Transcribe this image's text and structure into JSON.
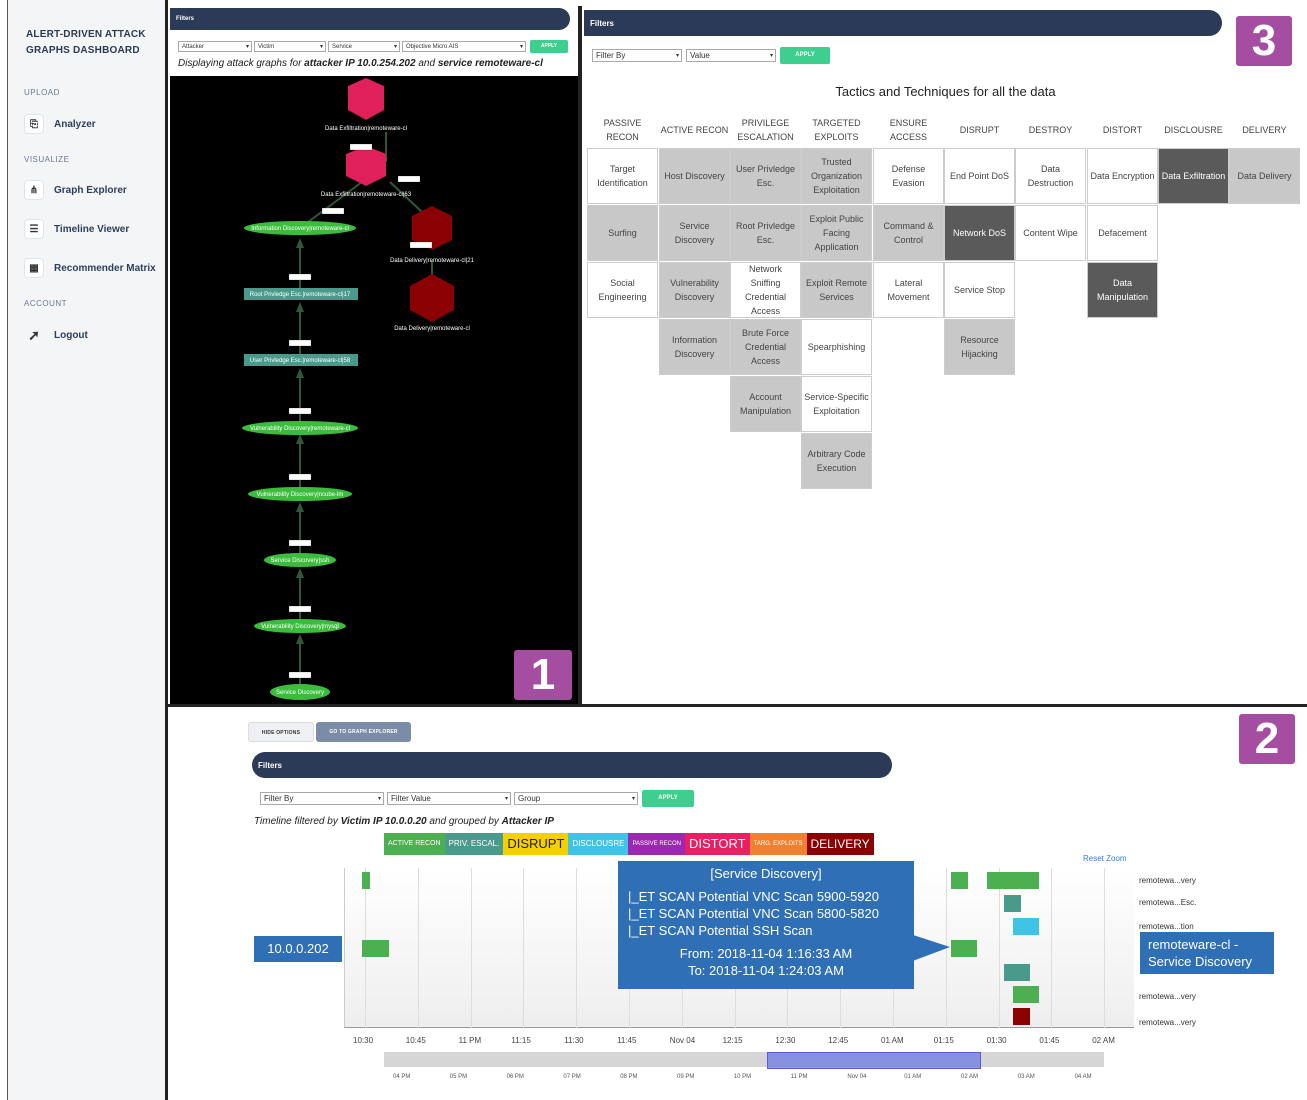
{
  "sidebar": {
    "brand": "ALERT-DRIVEN ATTACK GRAPHS DASHBOARD",
    "sections": {
      "upload": "UPLOAD",
      "visualize": "VISUALIZE",
      "account": "ACCOUNT"
    },
    "items": [
      {
        "label": "Analyzer",
        "icon": "file-upload-icon"
      },
      {
        "label": "Graph Explorer",
        "icon": "graph-icon"
      },
      {
        "label": "Timeline Viewer",
        "icon": "timeline-icon"
      },
      {
        "label": "Recommender Matrix",
        "icon": "grid-icon"
      },
      {
        "label": "Logout",
        "icon": "rocket-icon"
      }
    ]
  },
  "graph_explorer": {
    "panel_number": "1",
    "filters_title": "Filters",
    "selects": [
      "Attacker",
      "Victim",
      "Service",
      "Objective Micro AIS"
    ],
    "apply": "APPLY",
    "caption_pre": "Displaying attack graphs for ",
    "caption_b1": "attacker IP 10.0.254.202",
    "caption_mid": " and ",
    "caption_b2": "service remoteware-cl",
    "nodes": [
      {
        "label": "Data Exfiltration|remoteware-cl",
        "kind": "hex-red"
      },
      {
        "label": "Data Exfiltration|remoteware-cl|63",
        "kind": "hex-red"
      },
      {
        "label": "Data Delivery|remoteware-cl|21",
        "kind": "hex-dark"
      },
      {
        "label": "Data Delivery|remoteware-cl",
        "kind": "hex-dark"
      },
      {
        "label": "Information Discovery|remoteware-cl",
        "kind": "ellipse"
      },
      {
        "label": "Root Privledge Esc.|remoteware-cl|17",
        "kind": "rect"
      },
      {
        "label": "User Privledge Esc.|remoteware-cl|58",
        "kind": "rect"
      },
      {
        "label": "Vulnerability Discovery|remoteware-cl",
        "kind": "ellipse"
      },
      {
        "label": "Vulnerability Discovery|ncube-lm",
        "kind": "ellipse"
      },
      {
        "label": "Service Discovery|ssh",
        "kind": "ellipse"
      },
      {
        "label": "Vulnerability Discovery|mysql",
        "kind": "ellipse"
      },
      {
        "label": "Service Discovery",
        "kind": "ellipse"
      }
    ]
  },
  "matrix": {
    "panel_number": "3",
    "filters_title": "Filters",
    "filter_by": "Filter By",
    "value": "Value",
    "apply": "APPLY",
    "title": "Tactics and Techniques for all the data",
    "columns": [
      "PASSIVE RECON",
      "ACTIVE RECON",
      "PRIVILEGE ESCALATION",
      "TARGETED EXPLOITS",
      "ENSURE ACCESS",
      "DISRUPT",
      "DESTROY",
      "DISTORT",
      "DISCLOUSRE",
      "DELIVERY"
    ],
    "cells": [
      [
        {
          "t": "Target Identification",
          "s": "w"
        },
        {
          "t": "Surfing",
          "s": "g"
        },
        {
          "t": "Social Engineering",
          "s": "w"
        }
      ],
      [
        {
          "t": "Host Discovery",
          "s": "g"
        },
        {
          "t": "Service Discovery",
          "s": "g"
        },
        {
          "t": "Vulnerability Discovery",
          "s": "g"
        },
        {
          "t": "Information Discovery",
          "s": "g"
        }
      ],
      [
        {
          "t": "User Privledge Esc.",
          "s": "g"
        },
        {
          "t": "Root Privledge Esc.",
          "s": "g"
        },
        {
          "t": "Network Sniffing Credential Access",
          "s": "w"
        },
        {
          "t": "Brute Force Credential Access",
          "s": "g"
        },
        {
          "t": "Account Manipulation",
          "s": "g"
        }
      ],
      [
        {
          "t": "Trusted Organization Exploitation",
          "s": "g"
        },
        {
          "t": "Exploit Public Facing Application",
          "s": "g"
        },
        {
          "t": "Exploit Remote Services",
          "s": "g"
        },
        {
          "t": "Spearphishing",
          "s": "w"
        },
        {
          "t": "Service-Specific Exploitation",
          "s": "w"
        },
        {
          "t": "Arbitrary Code Execution",
          "s": "g"
        }
      ],
      [
        {
          "t": "Defense Evasion",
          "s": "w"
        },
        {
          "t": "Command & Control",
          "s": "g"
        },
        {
          "t": "Lateral Movement",
          "s": "w"
        }
      ],
      [
        {
          "t": "End Point DoS",
          "s": "w"
        },
        {
          "t": "Network DoS",
          "s": "dg"
        },
        {
          "t": "Service Stop",
          "s": "w"
        },
        {
          "t": "Resource Hijacking",
          "s": "g"
        }
      ],
      [
        {
          "t": "Data Destruction",
          "s": "w"
        },
        {
          "t": "Content Wipe",
          "s": "w"
        }
      ],
      [
        {
          "t": "Data Encryption",
          "s": "w"
        },
        {
          "t": "Defacement",
          "s": "w"
        },
        {
          "t": "Data Manipulation",
          "s": "dg"
        }
      ],
      [
        {
          "t": "Data Exfiltration",
          "s": "dg"
        }
      ],
      [
        {
          "t": "Data Delivery",
          "s": "g"
        }
      ]
    ]
  },
  "timeline": {
    "panel_number": "2",
    "hide_options": "HIDE OPTIONS",
    "goto_graph": "GO TO GRAPH EXPLORER",
    "filters_title": "Filters",
    "filter_by": "Filter By",
    "filter_value": "Filter Value",
    "group": "Group",
    "apply": "APPLY",
    "caption_pre": "Timeline filtered by ",
    "caption_b1": "Victim IP 10.0.0.20",
    "caption_mid": " and grouped by ",
    "caption_b2": "Attacker IP",
    "legend": [
      {
        "label": "ACTIVE RECON",
        "color": "#4caf50"
      },
      {
        "label": "PRIV. ESCAL.",
        "color": "#4a9a8c"
      },
      {
        "label": "DISRUPT",
        "color": "#f5d000"
      },
      {
        "label": "DISCLOUSRE",
        "color": "#3fc3e6"
      },
      {
        "label": "PASSIVE RECON",
        "color": "#9c27b0"
      },
      {
        "label": "DISTORT",
        "color": "#e91e63"
      },
      {
        "label": "TARG. EXPLOITS",
        "color": "#f08030"
      },
      {
        "label": "DELIVERY",
        "color": "#8b0000"
      }
    ],
    "reset_zoom": "Reset Zoom",
    "group_label": "10.0.0.202",
    "right_labels": [
      "remotewa...very",
      "remotewa...Esc.",
      "remotewa...tion",
      "remotewa...very",
      "remotewa...very"
    ],
    "hover_label": "remoteware-cl - Service Discovery",
    "tooltip": {
      "title": "[Service Discovery]",
      "lines": [
        "|_ET SCAN Potential VNC Scan 5900-5920",
        "|_ET SCAN Potential VNC Scan 5800-5820",
        "|_ET SCAN Potential SSH Scan"
      ],
      "from": "From: 2018-11-04 1:16:33 AM",
      "to": "To: 2018-11-04 1:24:03 AM"
    },
    "axis_ticks": [
      "10:30",
      "10:45",
      "11 PM",
      "11:15",
      "11:30",
      "11:45",
      "Nov 04",
      "12:15",
      "12:30",
      "12:45",
      "01 AM",
      "01:15",
      "01:30",
      "01:45",
      "02 AM"
    ],
    "nav_ticks": [
      "04 PM",
      "05 PM",
      "06 PM",
      "07 PM",
      "08 PM",
      "09 PM",
      "10 PM",
      "11 PM",
      "Nov 04",
      "01 AM",
      "02 AM",
      "03 AM",
      "04 AM"
    ]
  }
}
